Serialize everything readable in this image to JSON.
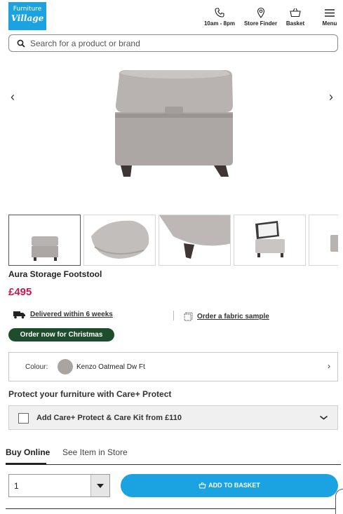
{
  "header": {
    "logo_line1": "Furniture",
    "logo_line2": "Village",
    "hours": "10am - 8pm",
    "store_finder": "Store Finder",
    "basket": "Basket",
    "menu": "Menu"
  },
  "search": {
    "placeholder": "Search for a product or brand"
  },
  "gallery": {
    "prev_icon": "chevron-left-icon",
    "next_icon": "chevron-right-icon",
    "prev_glyph": "‹",
    "next_glyph": "›"
  },
  "product": {
    "title": "Aura Storage Footstool",
    "price": "£495",
    "delivery": "Delivered within 6 weeks",
    "fabric_sample": "Order a fabric sample",
    "badge": "Order now for Christmas",
    "colour_label": "Colour:",
    "colour_value": "Kenzo Oatmeal Dw Ft",
    "colour_chevron": "›"
  },
  "protect": {
    "title": "Protect your furniture with Care+ Protect",
    "option": "Add Care+ Protect & Care Kit from £110"
  },
  "tabs": [
    {
      "label": "Buy Online"
    },
    {
      "label": "See Item in Store"
    }
  ],
  "purchase": {
    "quantity": "1",
    "add_to_basket": "ADD TO BASKET"
  },
  "colors": {
    "brand": "#1aa3e0",
    "price": "#c8194f",
    "badge": "#1e4d2b"
  }
}
